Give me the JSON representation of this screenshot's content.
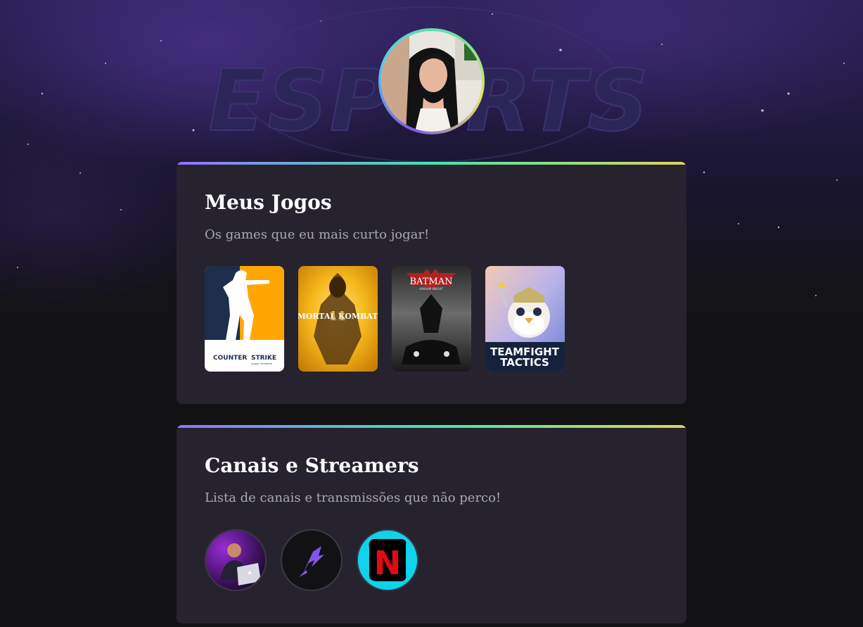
{
  "profile": {
    "avatar_alt": "Foto de perfil",
    "background_logo": "ESPORTS"
  },
  "games_section": {
    "title": "Meus Jogos",
    "subtitle": "Os games que eu mais curto jogar!",
    "games": [
      {
        "name": "Counter-Strike: Global Offensive",
        "label_line1": "COUNTER",
        "label_line2": "STRIKE",
        "small": "GLOBAL OFFENSIVE"
      },
      {
        "name": "Mortal Kombat 11",
        "label": "MORTAL KOMBAT",
        "number": "11"
      },
      {
        "name": "Batman: Arkham Knight",
        "label": "BATMAN",
        "small": "ARKHAM KNIGHT"
      },
      {
        "name": "Teamfight Tactics",
        "label_line1": "TEAMFIGHT",
        "label_line2": "TACTICS"
      }
    ]
  },
  "streams_section": {
    "title": "Canais e Streamers",
    "subtitle": "Lista de canais e transmissões que não perco!",
    "channels": [
      {
        "name": "Streamer com laptop",
        "icon": "streamer-avatar"
      },
      {
        "name": "Rocketseat",
        "icon": "rocket-logo"
      },
      {
        "name": "Netflix",
        "icon": "netflix-logo",
        "letter": "N"
      }
    ]
  },
  "colors": {
    "card_bg": "#26232f",
    "page_bg": "#121214",
    "title": "#ffffff",
    "subtitle": "#a8a8b3",
    "gradient_start": "#9572fc",
    "gradient_mid": "#43e7ad",
    "gradient_end": "#e2d45c"
  }
}
